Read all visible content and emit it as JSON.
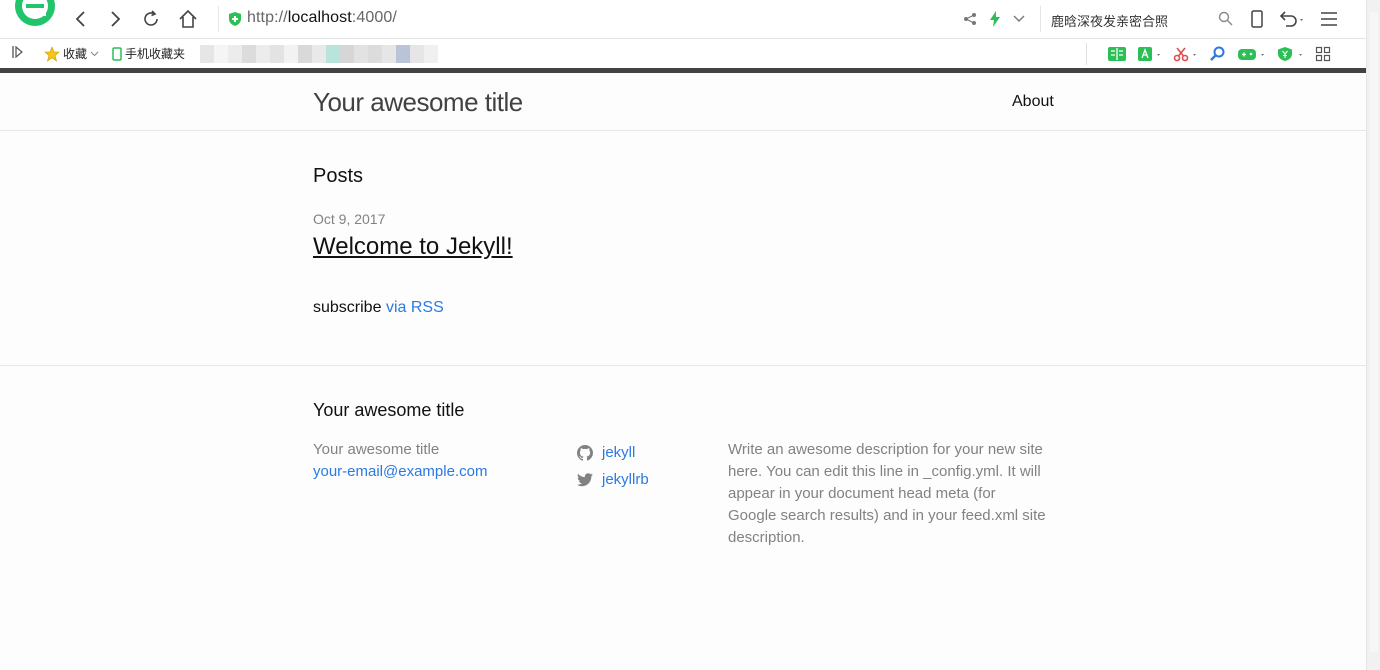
{
  "browser": {
    "url_scheme": "http://",
    "url_host": "localhost",
    "url_rest": ":4000/",
    "search_text": "鹿晗深夜发亲密合照",
    "bookmarks": {
      "favorites_label": "收藏",
      "mobile_label": "手机收藏夹"
    }
  },
  "site": {
    "title": "Your awesome title",
    "nav_about": "About"
  },
  "main": {
    "posts_heading": "Posts",
    "posts": [
      {
        "date": "Oct 9, 2017",
        "title": "Welcome to Jekyll!"
      }
    ],
    "subscribe_text": "subscribe",
    "rss_link": "via RSS"
  },
  "footer": {
    "heading": "Your awesome title",
    "site_name": "Your awesome title",
    "email": "your-email@example.com",
    "github": "jekyll",
    "twitter": "jekyllrb",
    "description": "Write an awesome description for your new site here. You can edit this line in _config.yml. It will appear in your document head meta (for Google search results) and in your feed.xml site description."
  },
  "colors": {
    "link": "#2a7ae2",
    "muted": "#828282",
    "header_bar": "#424242",
    "secure_green": "#2bbf56"
  },
  "icons": [
    "back-icon",
    "forward-icon",
    "reload-icon",
    "home-icon",
    "shield-icon",
    "share-icon",
    "bolt-icon",
    "search-icon",
    "tablet-icon",
    "undo-icon",
    "menu-icon",
    "star-icon",
    "phone-icon",
    "github-icon",
    "twitter-icon"
  ]
}
